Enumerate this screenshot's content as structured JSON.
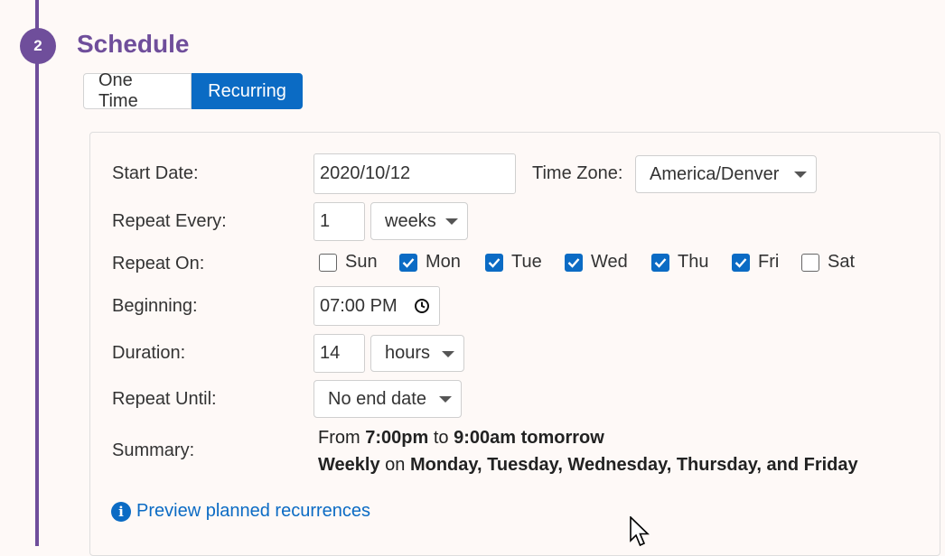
{
  "step": {
    "number": "2",
    "title": "Schedule"
  },
  "tabs": [
    {
      "label": "One Time",
      "active": false
    },
    {
      "label": "Recurring",
      "active": true
    }
  ],
  "form": {
    "start_date": {
      "label": "Start Date:",
      "value": "2020/10/12"
    },
    "time_zone": {
      "label": "Time Zone:",
      "value": "America/Denver"
    },
    "repeat_every": {
      "label": "Repeat Every:",
      "value": "1",
      "unit": "weeks"
    },
    "repeat_on": {
      "label": "Repeat On:",
      "days": [
        {
          "label": "Sun",
          "checked": false
        },
        {
          "label": "Mon",
          "checked": true
        },
        {
          "label": "Tue",
          "checked": true
        },
        {
          "label": "Wed",
          "checked": true
        },
        {
          "label": "Thu",
          "checked": true
        },
        {
          "label": "Fri",
          "checked": true
        },
        {
          "label": "Sat",
          "checked": false
        }
      ]
    },
    "beginning": {
      "label": "Beginning:",
      "value": "07:00 PM"
    },
    "duration": {
      "label": "Duration:",
      "value": "14",
      "unit": "hours"
    },
    "repeat_until": {
      "label": "Repeat Until:",
      "value": "No end date"
    },
    "summary": {
      "label": "Summary:",
      "line1": {
        "from": "From",
        "start": "7:00pm",
        "to": "to",
        "end": "9:00am tomorrow"
      },
      "line2": {
        "freq": "Weekly",
        "on": "on",
        "days": "Monday, Tuesday, Wednesday, Thursday, and Friday"
      }
    }
  },
  "preview_link": "Preview planned recurrences",
  "colors": {
    "accent": "#6f4e9b",
    "primary": "#0b6bc4",
    "background": "#fef9f7"
  }
}
